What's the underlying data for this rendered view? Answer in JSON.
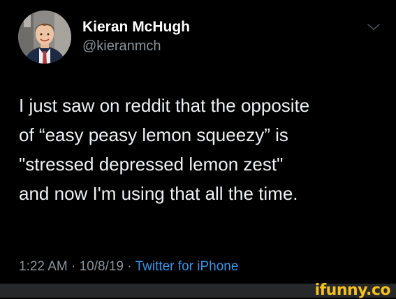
{
  "tweet": {
    "author_name": "Kieran McHugh",
    "author_handle": "@kieranmch",
    "text_lines": [
      "I just saw on reddit that the opposite",
      "of “easy peasy lemon squeezy” is",
      "\"stressed depressed lemon zest\"",
      "and now I'm using that all the time."
    ],
    "time": "1:22 AM",
    "separator": "·",
    "date": "10/8/19",
    "source": "Twitter for iPhone",
    "menu_icon": "chevron-down-icon"
  },
  "watermark": {
    "text": "ifunny.co"
  },
  "colors": {
    "background": "#000000",
    "text": "#eef0f2",
    "secondary": "#8a9299",
    "link": "#3a95e6",
    "watermark": "#f4c01c",
    "footer": "#27282a"
  }
}
